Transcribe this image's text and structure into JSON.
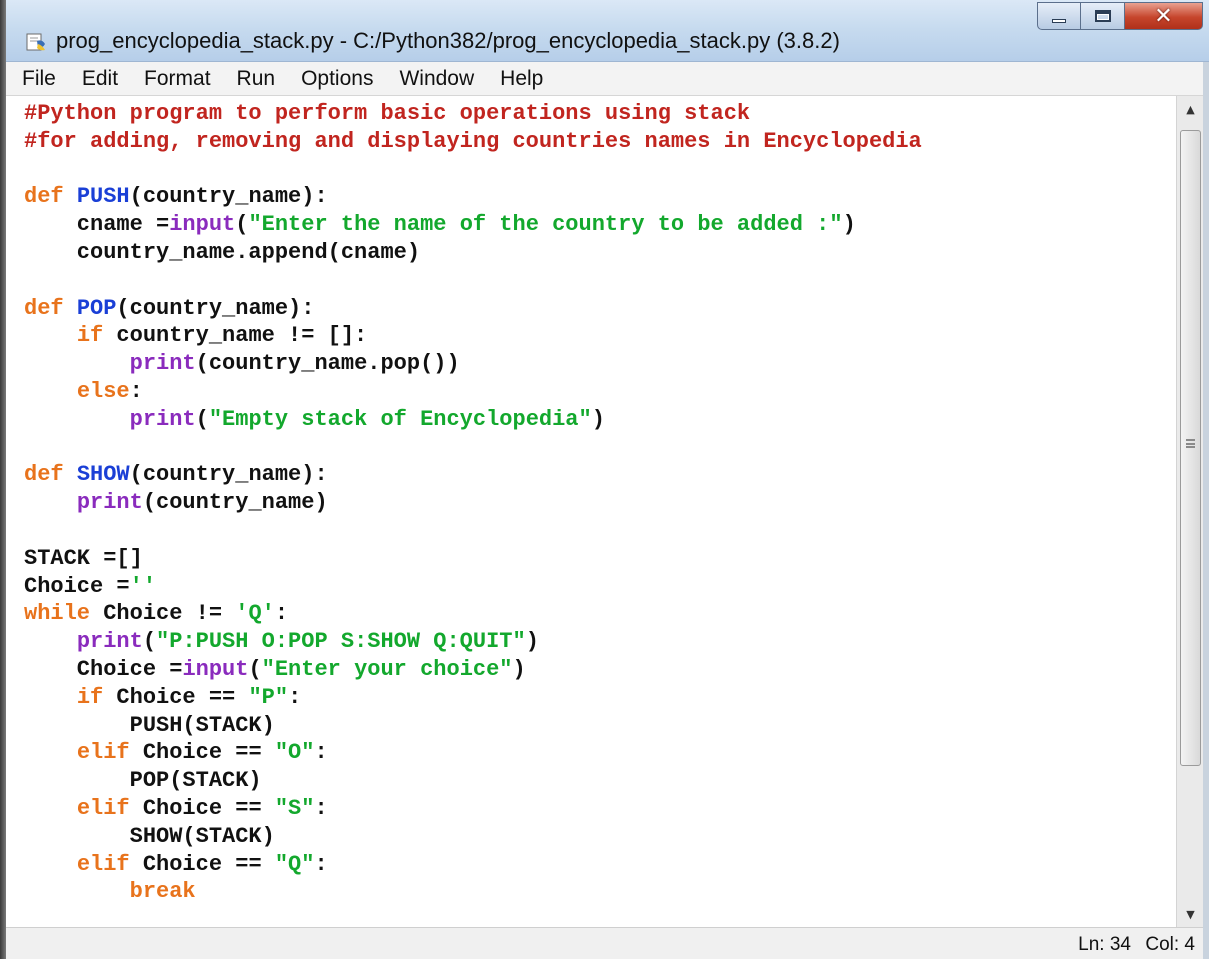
{
  "window": {
    "title": "prog_encyclopedia_stack.py - C:/Python382/prog_encyclopedia_stack.py (3.8.2)",
    "app_icon": "python-idle-icon"
  },
  "menu": [
    "File",
    "Edit",
    "Format",
    "Run",
    "Options",
    "Window",
    "Help"
  ],
  "editor": {
    "lines": [
      [
        {
          "t": "comment",
          "v": "#Python program to perform basic operations using stack"
        }
      ],
      [
        {
          "t": "comment",
          "v": "#for adding, removing and displaying countries names in Encyclopedia"
        }
      ],
      [],
      [
        {
          "t": "keyword",
          "v": "def "
        },
        {
          "t": "defname",
          "v": "PUSH"
        },
        {
          "t": "plain",
          "v": "(country_name):"
        }
      ],
      [
        {
          "t": "plain",
          "v": "    cname ="
        },
        {
          "t": "builtin",
          "v": "input"
        },
        {
          "t": "plain",
          "v": "("
        },
        {
          "t": "string",
          "v": "\"Enter the name of the country to be added :\""
        },
        {
          "t": "plain",
          "v": ")"
        }
      ],
      [
        {
          "t": "plain",
          "v": "    country_name.append(cname)"
        }
      ],
      [],
      [
        {
          "t": "keyword",
          "v": "def "
        },
        {
          "t": "defname",
          "v": "POP"
        },
        {
          "t": "plain",
          "v": "(country_name):"
        }
      ],
      [
        {
          "t": "plain",
          "v": "    "
        },
        {
          "t": "keyword",
          "v": "if"
        },
        {
          "t": "plain",
          "v": " country_name != []:"
        }
      ],
      [
        {
          "t": "plain",
          "v": "        "
        },
        {
          "t": "builtin",
          "v": "print"
        },
        {
          "t": "plain",
          "v": "(country_name.pop())"
        }
      ],
      [
        {
          "t": "plain",
          "v": "    "
        },
        {
          "t": "keyword",
          "v": "else"
        },
        {
          "t": "plain",
          "v": ":"
        }
      ],
      [
        {
          "t": "plain",
          "v": "        "
        },
        {
          "t": "builtin",
          "v": "print"
        },
        {
          "t": "plain",
          "v": "("
        },
        {
          "t": "string",
          "v": "\"Empty stack of Encyclopedia\""
        },
        {
          "t": "plain",
          "v": ")"
        }
      ],
      [],
      [
        {
          "t": "keyword",
          "v": "def "
        },
        {
          "t": "defname",
          "v": "SHOW"
        },
        {
          "t": "plain",
          "v": "(country_name):"
        }
      ],
      [
        {
          "t": "plain",
          "v": "    "
        },
        {
          "t": "builtin",
          "v": "print"
        },
        {
          "t": "plain",
          "v": "(country_name)"
        }
      ],
      [],
      [
        {
          "t": "plain",
          "v": "STACK =[]"
        }
      ],
      [
        {
          "t": "plain",
          "v": "Choice ="
        },
        {
          "t": "string",
          "v": "''"
        }
      ],
      [
        {
          "t": "keyword",
          "v": "while"
        },
        {
          "t": "plain",
          "v": " Choice != "
        },
        {
          "t": "string",
          "v": "'Q'"
        },
        {
          "t": "plain",
          "v": ":"
        }
      ],
      [
        {
          "t": "plain",
          "v": "    "
        },
        {
          "t": "builtin",
          "v": "print"
        },
        {
          "t": "plain",
          "v": "("
        },
        {
          "t": "string",
          "v": "\"P:PUSH O:POP S:SHOW Q:QUIT\""
        },
        {
          "t": "plain",
          "v": ")"
        }
      ],
      [
        {
          "t": "plain",
          "v": "    Choice ="
        },
        {
          "t": "builtin",
          "v": "input"
        },
        {
          "t": "plain",
          "v": "("
        },
        {
          "t": "string",
          "v": "\"Enter your choice\""
        },
        {
          "t": "plain",
          "v": ")"
        }
      ],
      [
        {
          "t": "plain",
          "v": "    "
        },
        {
          "t": "keyword",
          "v": "if"
        },
        {
          "t": "plain",
          "v": " Choice == "
        },
        {
          "t": "string",
          "v": "\"P\""
        },
        {
          "t": "plain",
          "v": ":"
        }
      ],
      [
        {
          "t": "plain",
          "v": "        PUSH(STACK)"
        }
      ],
      [
        {
          "t": "plain",
          "v": "    "
        },
        {
          "t": "keyword",
          "v": "elif"
        },
        {
          "t": "plain",
          "v": " Choice == "
        },
        {
          "t": "string",
          "v": "\"O\""
        },
        {
          "t": "plain",
          "v": ":"
        }
      ],
      [
        {
          "t": "plain",
          "v": "        POP(STACK)"
        }
      ],
      [
        {
          "t": "plain",
          "v": "    "
        },
        {
          "t": "keyword",
          "v": "elif"
        },
        {
          "t": "plain",
          "v": " Choice == "
        },
        {
          "t": "string",
          "v": "\"S\""
        },
        {
          "t": "plain",
          "v": ":"
        }
      ],
      [
        {
          "t": "plain",
          "v": "        SHOW(STACK)"
        }
      ],
      [
        {
          "t": "plain",
          "v": "    "
        },
        {
          "t": "keyword",
          "v": "elif"
        },
        {
          "t": "plain",
          "v": " Choice == "
        },
        {
          "t": "string",
          "v": "\"Q\""
        },
        {
          "t": "plain",
          "v": ":"
        }
      ],
      [
        {
          "t": "plain",
          "v": "        "
        },
        {
          "t": "keyword",
          "v": "break"
        }
      ]
    ]
  },
  "status": {
    "ln": "Ln: 34",
    "col": "Col: 4"
  },
  "colors": {
    "comment": "#c1251f",
    "keyword": "#e8731c",
    "builtin": "#8a2bbd",
    "string": "#13a82d",
    "defname": "#1a3fd6",
    "close_button": "#c6452c"
  }
}
